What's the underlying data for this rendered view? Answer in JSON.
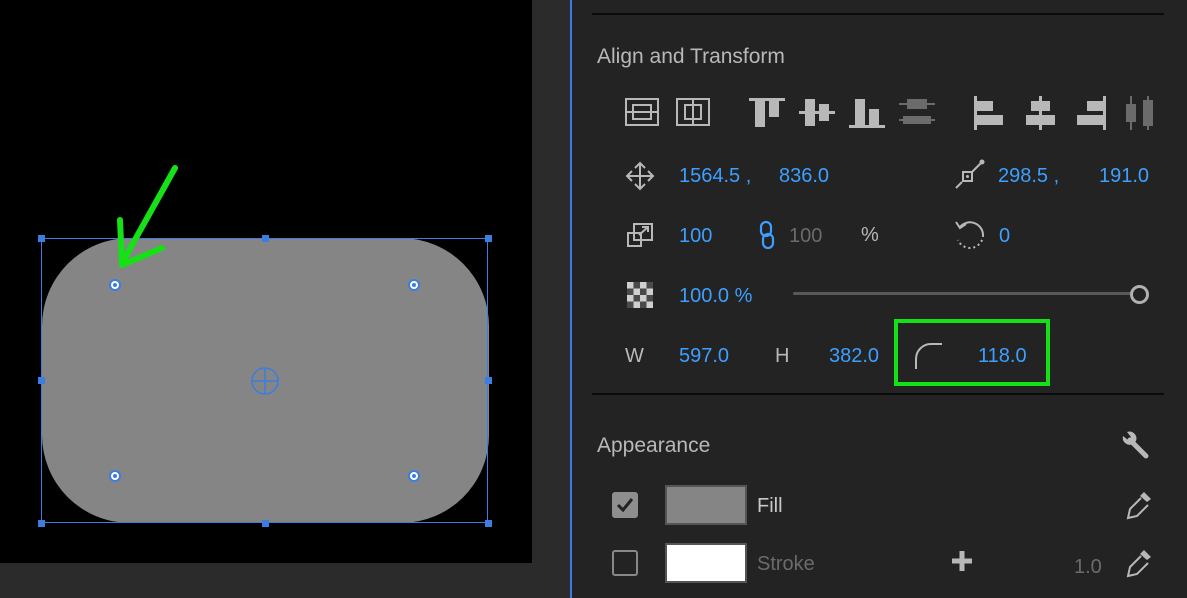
{
  "canvas": {
    "shape_color": "#858585",
    "selection_color": "#3d7de0",
    "annotation_color": "#16e016"
  },
  "align_transform": {
    "title": "Align and Transform",
    "position": {
      "x": "1564.5 ,",
      "y": "836.0"
    },
    "anchor": {
      "x": "298.5 ,",
      "y": "191.0"
    },
    "scale": {
      "width": "100",
      "height": "100",
      "unit": "%"
    },
    "rotation": "0",
    "opacity": "100.0 %",
    "opacity_fraction": 1.0,
    "width_label": "W",
    "width_value": "597.0",
    "height_label": "H",
    "height_value": "382.0",
    "corner_radius": "118.0",
    "icons": [
      "align-to-selection-icon",
      "align-to-video-frame-icon",
      "align-top-icon",
      "align-vertical-center-icon",
      "align-bottom-icon",
      "distribute-vertical-icon",
      "align-left-icon",
      "align-horizontal-center-icon",
      "align-right-icon",
      "distribute-horizontal-icon",
      "move-icon",
      "anchor-point-icon",
      "scale-icon",
      "link-icon",
      "rotation-icon",
      "opacity-icon",
      "corner-radius-icon"
    ]
  },
  "appearance": {
    "title": "Appearance",
    "fill": {
      "label": "Fill",
      "checked": true,
      "color": "#858585"
    },
    "stroke": {
      "label": "Stroke",
      "checked": false,
      "color": "#ffffff",
      "width": "1.0"
    }
  }
}
